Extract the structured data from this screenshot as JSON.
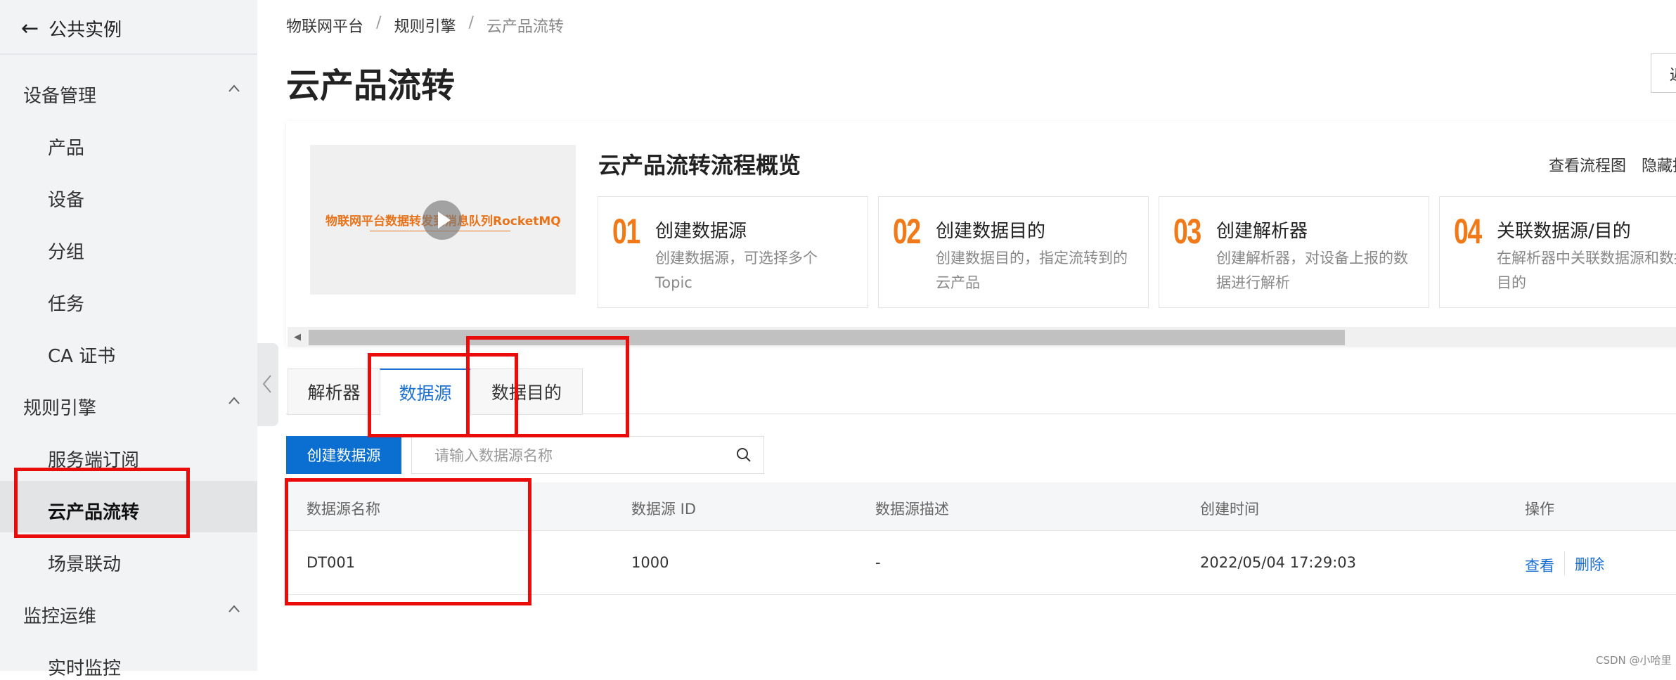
{
  "sidebar": {
    "back_label": "公共实例",
    "groups": [
      {
        "label": "设备管理",
        "items": [
          "产品",
          "设备",
          "分组",
          "任务",
          "CA 证书"
        ]
      },
      {
        "label": "规则引擎",
        "items": [
          "服务端订阅",
          "云产品流转",
          "场景联动"
        ]
      },
      {
        "label": "监控运维",
        "items": [
          "实时监控"
        ]
      }
    ],
    "active_item": "云产品流转"
  },
  "breadcrumb": [
    "物联网平台",
    "规则引擎",
    "云产品流转"
  ],
  "breadcrumb_separator": "/",
  "page_title": "云产品流转",
  "overview": {
    "video_caption": "物联网平台数据转发到消息队列RocketMQ",
    "title": "云产品流转流程概览",
    "links": [
      "查看流程图",
      "隐藏指"
    ],
    "steps": [
      {
        "num": "01",
        "title": "创建数据源",
        "desc": "创建数据源，可选择多个 Topic"
      },
      {
        "num": "02",
        "title": "创建数据目的",
        "desc": "创建数据目的，指定流转到的云产品"
      },
      {
        "num": "03",
        "title": "创建解析器",
        "desc": "创建解析器，对设备上报的数据进行解析"
      },
      {
        "num": "04",
        "title": "关联数据源/目的",
        "desc": "在解析器中关联数据源和数据目的"
      }
    ]
  },
  "corner_button_label": "返",
  "tabs": [
    "解析器",
    "数据源",
    "数据目的"
  ],
  "active_tab": "数据源",
  "toolbar": {
    "create_label": "创建数据源",
    "search_placeholder": "请输入数据源名称"
  },
  "table": {
    "columns": [
      "数据源名称",
      "数据源 ID",
      "数据源描述",
      "创建时间",
      "操作"
    ],
    "rows": [
      {
        "name": "DT001",
        "id": "1000",
        "desc": "-",
        "created": "2022/05/04 17:29:03",
        "actions": [
          "查看",
          "删除"
        ]
      }
    ]
  },
  "watermark": "CSDN @小哈里",
  "colors": {
    "accent": "#0a6fd1",
    "step_number": "#f07a1a",
    "highlight": "#ea0b0b"
  }
}
